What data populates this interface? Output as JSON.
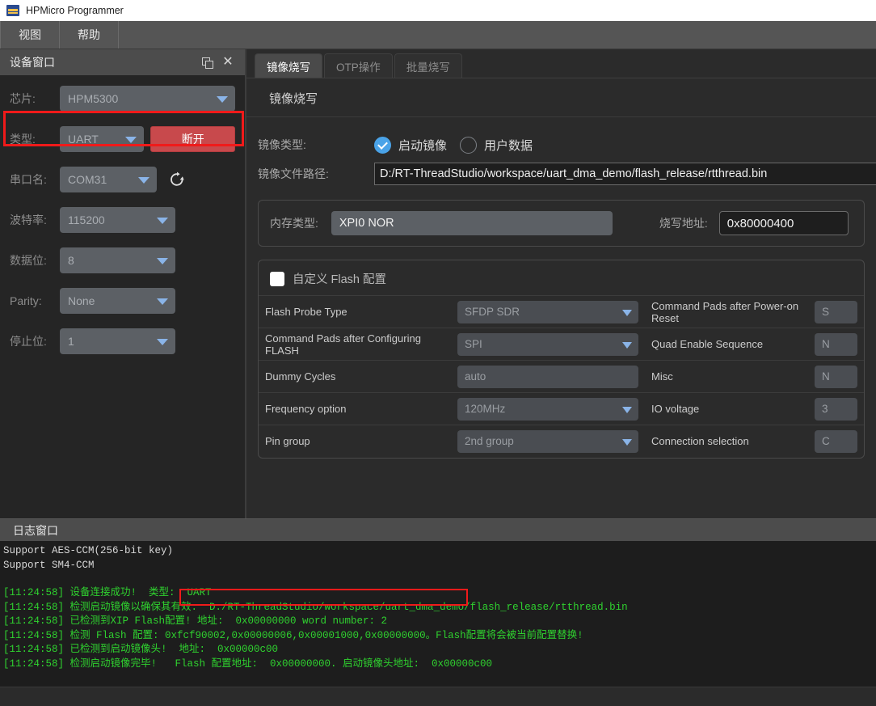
{
  "window": {
    "title": "HPMicro Programmer",
    "icon": "app-icon"
  },
  "menubar": {
    "items": [
      {
        "label": "视图"
      },
      {
        "label": "帮助"
      }
    ]
  },
  "device_panel": {
    "title": "设备窗口",
    "float_icon": "restore-icon",
    "close_icon": "close-icon",
    "refresh_icon": "refresh-icon",
    "fields": [
      {
        "label": "芯片:",
        "value": "HPM5300"
      },
      {
        "label": "类型:",
        "value": "UART"
      },
      {
        "label": "串口名:",
        "value": "COM31"
      },
      {
        "label": "波特率:",
        "value": "115200"
      },
      {
        "label": "数据位:",
        "value": "8"
      },
      {
        "label": "Parity:",
        "value": "None"
      },
      {
        "label": "停止位:",
        "value": "1"
      }
    ],
    "disconnect_button": "断开",
    "highlight_color": "#f01a1a"
  },
  "tabs": [
    {
      "label": "镜像烧写",
      "active": true
    },
    {
      "label": "OTP操作",
      "active": false
    },
    {
      "label": "批量烧写",
      "active": false
    }
  ],
  "main": {
    "section_title": "镜像烧写",
    "image_type": {
      "label": "镜像类型:",
      "options": [
        {
          "label": "启动镜像",
          "selected": true
        },
        {
          "label": "用户数据",
          "selected": false
        }
      ]
    },
    "image_path": {
      "label": "镜像文件路径:",
      "value": "D:/RT-ThreadStudio/workspace/uart_dma_demo/flash_release/rtthread.bin"
    },
    "memory": {
      "label": "内存类型:",
      "value": "XPI0 NOR",
      "address_label": "烧写地址:",
      "address_value": "0x80000400"
    },
    "flash_config": {
      "checkbox_label": "自定义 Flash 配置",
      "checked": false,
      "rows": [
        {
          "left_label": "Flash Probe Type",
          "left_value": "SFDP SDR",
          "left_dropdown": true,
          "right_label": "Command Pads after Power-on Reset",
          "right_value": "S",
          "right_dropdown": false
        },
        {
          "left_label": "Command Pads after Configuring FLASH",
          "left_value": "SPI",
          "left_dropdown": true,
          "right_label": "Quad Enable Sequence",
          "right_value": "N",
          "right_dropdown": false
        },
        {
          "left_label": "Dummy Cycles",
          "left_value": "auto",
          "left_dropdown": false,
          "right_label": "Misc",
          "right_value": "N",
          "right_dropdown": false
        },
        {
          "left_label": "Frequency option",
          "left_value": "120MHz",
          "left_dropdown": true,
          "right_label": "IO voltage",
          "right_value": "3",
          "right_dropdown": false
        },
        {
          "left_label": "Pin group",
          "left_value": "2nd group",
          "left_dropdown": true,
          "right_label": "Connection selection",
          "right_value": "C",
          "right_dropdown": false
        }
      ]
    }
  },
  "log": {
    "title": "日志窗口",
    "lines": [
      {
        "text": "Support AES-CCM(256-bit key)",
        "color": "white"
      },
      {
        "text": "Support SM4-CCM",
        "color": "white"
      },
      {
        "text": "",
        "color": "white"
      },
      {
        "text": "[11:24:58] 设备连接成功!  类型:  UART",
        "color": "green"
      },
      {
        "text": "[11:24:58] 检测启动镜像以确保其有效:  D:/RT-ThreadStudio/workspace/uart_dma_demo/flash_release/rtthread.bin",
        "color": "green"
      },
      {
        "text": "[11:24:58] 已检测到XIP Flash配置! 地址:  0x00000000 word number: 2",
        "color": "green"
      },
      {
        "text": "[11:24:58] 检测 Flash 配置: 0xfcf90002,0x00000006,0x00001000,0x00000000。Flash配置将会被当前配置替换!",
        "color": "green"
      },
      {
        "text": "[11:24:58] 已检测到启动镜像头!  地址:  0x00000c00",
        "color": "green"
      },
      {
        "text": "[11:24:58] 检测启动镜像完毕!   Flash 配置地址:  0x00000000. 启动镜像头地址:  0x00000c00",
        "color": "green"
      }
    ],
    "highlight_text": "0xfcf90002,0x00000006,0x00001000,0x00000000。"
  }
}
